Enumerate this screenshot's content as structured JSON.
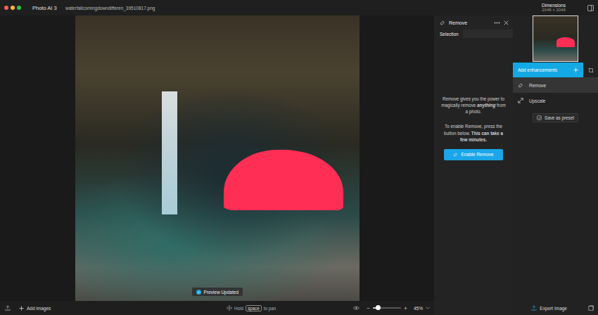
{
  "window": {
    "title": "Photo AI 3",
    "filename": "waterfallcomingdowndifferen_39510817.png"
  },
  "dimensions": {
    "label": "Dimensions",
    "value": "2048 × 2048"
  },
  "toast": "Preview Updated",
  "remove_panel": {
    "title": "Remove",
    "selection_label": "Selection",
    "intro": [
      {
        "text": "Remove gives you the power to magically remove ",
        "emphasis": "none"
      },
      {
        "text": "anything",
        "emphasis": "bold-italic"
      },
      {
        "text": " from a photo.",
        "emphasis": "none"
      }
    ],
    "note": [
      {
        "text": "To enable Remove, press the button below. ",
        "emphasis": "none"
      },
      {
        "text": "This can take a few minutes.",
        "emphasis": "bold"
      }
    ],
    "button": "Enable Remove"
  },
  "enhancements": {
    "add_label": "Add enhancements",
    "items": [
      {
        "label": "Remove",
        "kind": "remove",
        "selected": true
      },
      {
        "label": "Upscale",
        "kind": "upscale",
        "selected": false
      }
    ],
    "preset_button": "Save as preset"
  },
  "bottom_bar": {
    "add_images": "Add images",
    "pan_hint": {
      "before": "Hold",
      "key": "space",
      "after": "to pan"
    },
    "zoom": {
      "level": 0.2,
      "reading": "45%"
    },
    "export": "Export Image"
  }
}
